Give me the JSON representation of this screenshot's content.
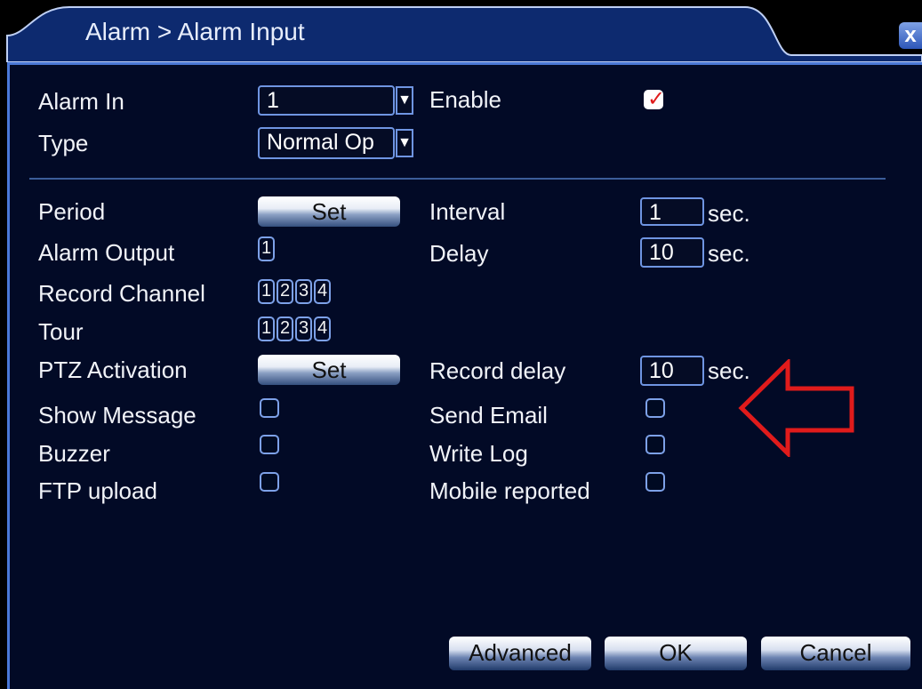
{
  "window": {
    "title": "Alarm > Alarm Input",
    "close_label": "x"
  },
  "labels": {
    "alarm_in": "Alarm In",
    "type": "Type",
    "enable": "Enable",
    "period": "Period",
    "interval": "Interval",
    "alarm_output": "Alarm Output",
    "delay": "Delay",
    "record_channel": "Record Channel",
    "tour": "Tour",
    "ptz_activation": "PTZ Activation",
    "record_delay": "Record delay",
    "show_message": "Show Message",
    "send_email": "Send Email",
    "buzzer": "Buzzer",
    "write_log": "Write Log",
    "ftp_upload": "FTP upload",
    "mobile_reported": "Mobile reported",
    "sec": "sec."
  },
  "values": {
    "alarm_in": "1",
    "type": "Normal Op",
    "interval": "1",
    "delay": "10",
    "record_delay": "10"
  },
  "channels": {
    "alarm_output": [
      "1"
    ],
    "record_channel": [
      "1",
      "2",
      "3",
      "4"
    ],
    "tour": [
      "1",
      "2",
      "3",
      "4"
    ]
  },
  "buttons": {
    "set": "Set",
    "advanced": "Advanced",
    "ok": "OK",
    "cancel": "Cancel"
  },
  "checkboxes": {
    "enable": true,
    "show_message": false,
    "send_email": false,
    "buzzer": false,
    "write_log": false,
    "ftp_upload": false,
    "mobile_reported": false
  },
  "icons": {
    "close": "close-icon",
    "dropdown": "chevron-down-icon",
    "check": "checkmark-icon",
    "annotation": "arrow-left-icon"
  },
  "colors": {
    "panel": "#020a26",
    "accent": "#4a78d6",
    "annotation_arrow": "#e01b1b"
  }
}
